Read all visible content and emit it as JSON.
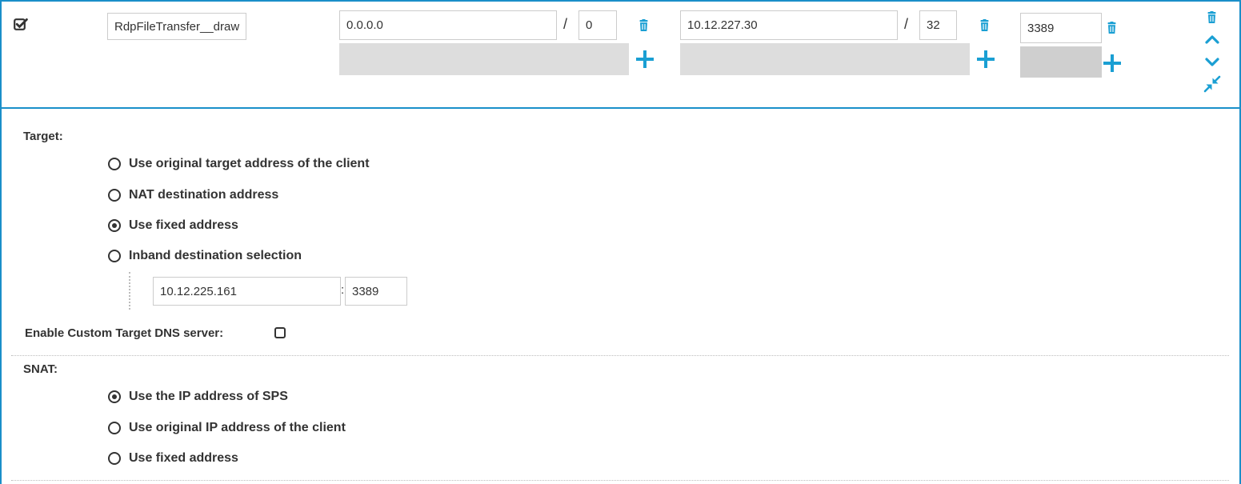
{
  "row": {
    "enabled": true,
    "name_value": "RdpFileTransfer__drawing",
    "from_address": "0.0.0.0",
    "from_prefix": "0",
    "to_address": "10.12.227.30",
    "to_prefix": "32",
    "port": "3389"
  },
  "target": {
    "label": "Target:",
    "options": [
      {
        "label": "Use original target address of the client",
        "selected": false
      },
      {
        "label": "NAT destination address",
        "selected": false
      },
      {
        "label": "Use fixed address",
        "selected": true
      },
      {
        "label": "Inband destination selection",
        "selected": false
      }
    ],
    "fixed_address": "10.12.225.161",
    "fixed_separator": ":",
    "fixed_port": "3389"
  },
  "dns": {
    "label": "Enable Custom Target DNS server:",
    "checked": false
  },
  "snat": {
    "label": "SNAT:",
    "options": [
      {
        "label": "Use the IP address of SPS",
        "selected": true
      },
      {
        "label": "Use original IP address of the client",
        "selected": false
      },
      {
        "label": "Use fixed address",
        "selected": false
      }
    ]
  },
  "separators": {
    "slash": "/"
  },
  "colors": {
    "accent": "#1a8fc9",
    "text": "#333333",
    "border": "#cccccc"
  },
  "icons": {
    "checkbox": "checkbox-checked-icon",
    "delete": "trash-icon",
    "add": "plus-icon",
    "up": "chevron-up-icon",
    "down": "chevron-down-icon",
    "collapse": "collapse-icon"
  }
}
